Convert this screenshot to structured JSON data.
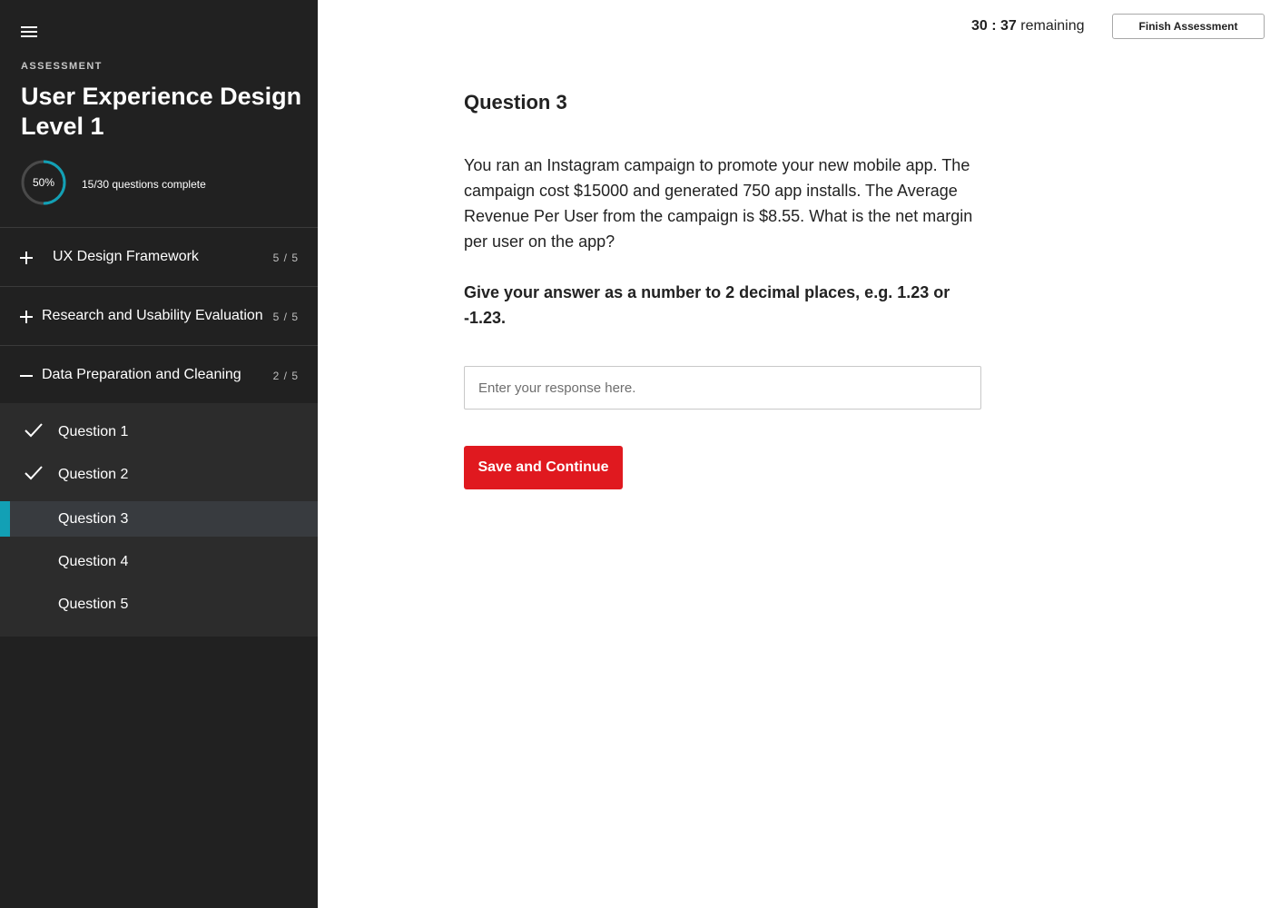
{
  "colors": {
    "sidebar_bg": "#212121",
    "question_list_bg": "#2c2c2c",
    "active_row_bg": "#383b3f",
    "accent": "#12a0b5",
    "primary_button": "#e0191f"
  },
  "sidebar": {
    "menu_icon": "hamburger-menu-icon",
    "kicker": "ASSESSMENT",
    "title": "User Experience Design Level 1",
    "progress": {
      "percent_label": "50%",
      "fraction": 0.5,
      "text": "15/30 questions complete"
    },
    "sections": [
      {
        "label": "UX Design Framework",
        "count": "5 / 5",
        "expanded": false,
        "icon": "plus-icon"
      },
      {
        "label": "Research and Usability Evaluation",
        "count": "5 / 5",
        "expanded": false,
        "icon": "plus-icon"
      },
      {
        "label": "Data Preparation and Cleaning",
        "count": "2 / 5",
        "expanded": true,
        "icon": "minus-icon"
      }
    ],
    "questions": [
      {
        "label": "Question 1",
        "completed": true,
        "active": false
      },
      {
        "label": "Question 2",
        "completed": true,
        "active": false
      },
      {
        "label": "Question 3",
        "completed": false,
        "active": true
      },
      {
        "label": "Question 4",
        "completed": false,
        "active": false
      },
      {
        "label": "Question 5",
        "completed": false,
        "active": false
      }
    ]
  },
  "header": {
    "timer_value": "30 : 37",
    "timer_suffix": "remaining",
    "finish_label": "Finish Assessment"
  },
  "main": {
    "question_title": "Question 3",
    "question_body": "You ran an Instagram campaign to promote your new mobile app. The campaign cost $15000 and generated 750 app installs. The Average Revenue Per User from the campaign is $8.55. What is the net margin per user on the app?",
    "instruction": "Give your answer as a number to 2 decimal places, e.g. 1.23 or -1.23.",
    "answer": {
      "value": "",
      "placeholder": "Enter your response here."
    },
    "submit_label": "Save and Continue"
  }
}
